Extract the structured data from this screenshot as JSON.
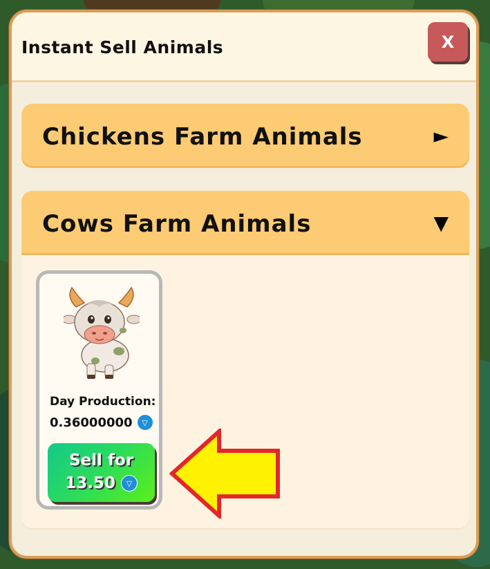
{
  "dialog": {
    "title": "Instant Sell Animals",
    "close_label": "X"
  },
  "sections": [
    {
      "title": "Chickens Farm Animals",
      "expanded": false,
      "toggle_icon": "►"
    },
    {
      "title": "Cows Farm Animals",
      "expanded": true,
      "toggle_icon": "▼",
      "cards": [
        {
          "image": "cow-icon",
          "production_label": "Day Production:",
          "production_value": "0.36000000",
          "currency_icon": "ton-icon",
          "sell_label": "Sell for",
          "sell_price": "13.50"
        }
      ]
    }
  ],
  "colors": {
    "accent_orange": "#fdcb73",
    "close_red": "#c8595a",
    "sell_green": "#2ddc59",
    "annotation_arrow": "#fff200"
  }
}
